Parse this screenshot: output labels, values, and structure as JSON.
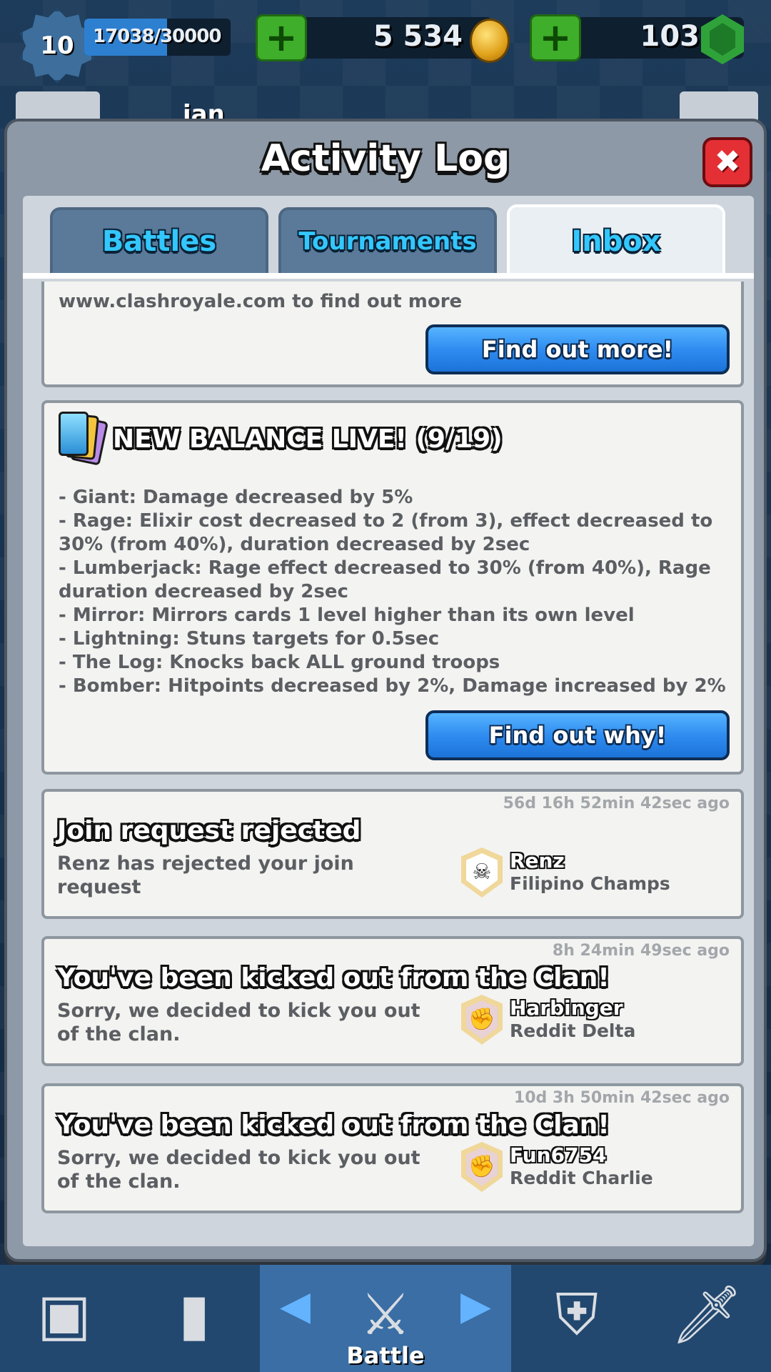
{
  "hud": {
    "level": "10",
    "xp_text": "17038/30000",
    "xp_progress": 0.568,
    "gold": "5 534",
    "gems": "103"
  },
  "background": {
    "player_name": "ian"
  },
  "modal": {
    "title": "Activity Log",
    "close_label": "✖",
    "tabs": [
      {
        "label": "Battles"
      },
      {
        "label": "Tournaments"
      },
      {
        "label": "Inbox"
      }
    ],
    "active_tab": "Inbox"
  },
  "inbox": {
    "partial_card": {
      "text": "www.clashroyale.com to find out more",
      "button": "Find out more!"
    },
    "balance_card": {
      "title": "NEW BALANCE LIVE! (9/19)",
      "lines": [
        "- Giant: Damage decreased by 5%",
        "- Rage: Elixir cost decreased to 2 (from 3), effect decreased to 30% (from 40%), duration decreased by 2sec",
        "- Lumberjack: Rage effect decreased to 30% (from 40%), Rage duration decreased by 2sec",
        "- Mirror: Mirrors cards 1 level higher than its own level",
        "- Lightning: Stuns targets for 0.5sec",
        "- The Log: Knocks back ALL ground troops",
        "- Bomber: Hitpoints decreased by 2%, Damage increased by 2%"
      ],
      "button": "Find out why!"
    },
    "messages": [
      {
        "timestamp": "56d 16h 52min  42sec ago",
        "title": "Join request rejected",
        "body": "Renz has rejected your join request",
        "player": "Renz",
        "clan": "Filipino Champs",
        "badge_icon": "skull-badge-icon"
      },
      {
        "timestamp": "8h 24min  49sec ago",
        "title": "You've been kicked out from the Clan!",
        "body": "Sorry, we decided to kick you out of the clan.",
        "player": "Harbinger",
        "clan": "Reddit Delta",
        "badge_icon": "fist-badge-icon"
      },
      {
        "timestamp": "10d 3h 50min  42sec ago",
        "title": "You've been kicked out from the Clan!",
        "body": "Sorry, we decided to kick you out of the clan.",
        "player": "Fun6754",
        "clan": "Reddit Charlie",
        "badge_icon": "fist-badge-icon"
      }
    ]
  },
  "bottom_nav": {
    "center_label": "Battle"
  }
}
